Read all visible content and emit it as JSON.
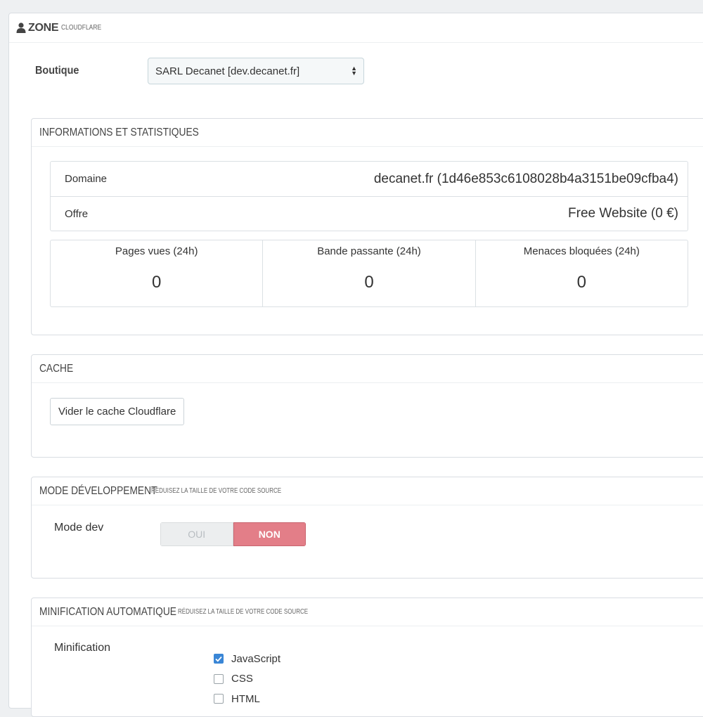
{
  "header": {
    "title": "ZONE",
    "subtitle": "CLOUDFLARE"
  },
  "boutique": {
    "label": "Boutique",
    "selected": "SARL Decanet [dev.decanet.fr]"
  },
  "info_panel": {
    "title": "INFORMATIONS ET STATISTIQUES",
    "rows": [
      {
        "key": "Domaine",
        "value": "decanet.fr (1d46e853c6108028b4a3151be09cfba4)"
      },
      {
        "key": "Offre",
        "value": "Free Website (0 €)"
      }
    ],
    "stats": [
      {
        "label": "Pages vues (24h)",
        "value": "0"
      },
      {
        "label": "Bande passante (24h)",
        "value": "0"
      },
      {
        "label": "Menaces bloquées (24h)",
        "value": "0"
      }
    ]
  },
  "cache_panel": {
    "title": "CACHE",
    "button_label": "Vider le cache Cloudflare"
  },
  "dev_panel": {
    "title": "MODE DÉVELOPPEMENT",
    "subtitle": "RÉDUISEZ LA TAILLE DE VOTRE CODE SOURCE",
    "field_label": "Mode dev",
    "option_yes": "OUI",
    "option_no": "NON",
    "selected": "NON"
  },
  "minify_panel": {
    "title": "MINIFICATION AUTOMATIQUE",
    "subtitle": "RÉDUISEZ LA TAILLE DE VOTRE CODE SOURCE",
    "field_label": "Minification",
    "options": [
      {
        "label": "JavaScript",
        "checked": true
      },
      {
        "label": "CSS",
        "checked": false
      },
      {
        "label": "HTML",
        "checked": false
      }
    ]
  },
  "colors": {
    "toggle_active": "#e37e88",
    "checkbox_checked": "#3a86d6"
  }
}
